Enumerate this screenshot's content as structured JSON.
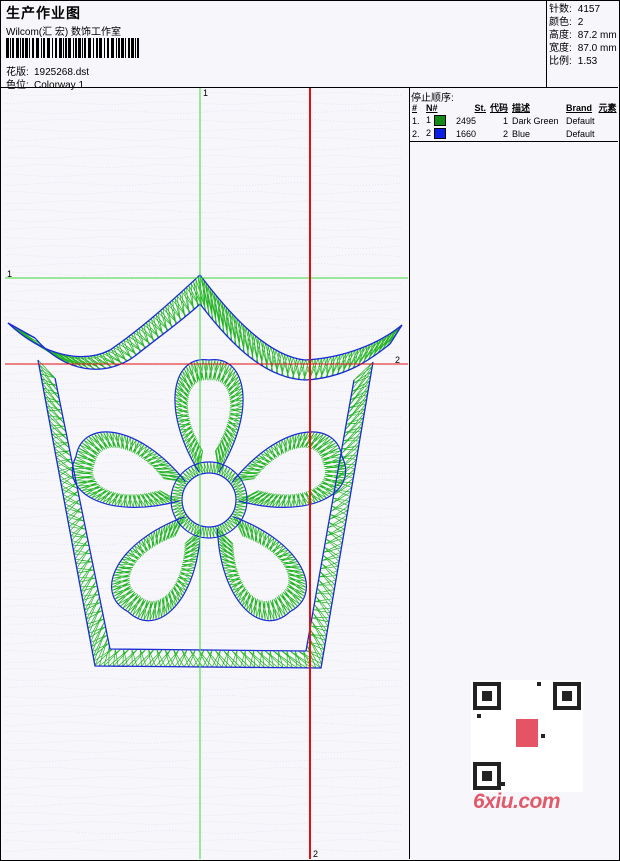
{
  "header": {
    "title": "生产作业图",
    "studio": "Wilcom(汇 宏) 数饰工作室",
    "pattern_label": "花版:",
    "pattern_value": "1925268.dst",
    "colorway_label": "色位:",
    "colorway_value": "Colorway 1"
  },
  "stats": {
    "stitches_label": "针数:",
    "stitches_value": "4157",
    "colors_label": "颜色:",
    "colors_value": "2",
    "height_label": "高度:",
    "height_value": "87.2 mm",
    "width_label": "宽度:",
    "width_value": "87.0 mm",
    "scale_label": "比例:",
    "scale_value": "1.53"
  },
  "stop_sequence": {
    "title": "停止顺序:",
    "headers": [
      "#",
      "N#",
      "St.",
      "代码",
      "描述",
      "Brand",
      "元素"
    ],
    "rows": [
      {
        "num": "1.",
        "n": "1",
        "stitches": "2495",
        "code": "1",
        "desc": "Dark Green",
        "brand": "Default",
        "color": "#138a13"
      },
      {
        "num": "2.",
        "n": "2",
        "stitches": "1660",
        "code": "2",
        "desc": "Blue",
        "brand": "Default",
        "color": "#0a1ee6"
      }
    ]
  },
  "guides": {
    "green_top": "1",
    "green_left": "1",
    "red_right": "2",
    "red_bottom": "2"
  },
  "watermark": "6xiu.com",
  "colors": {
    "green_stitch": "#22b422",
    "blue_outline": "#1a2ad8",
    "guide_green": "#3ed83e",
    "guide_red": "#e01010"
  }
}
